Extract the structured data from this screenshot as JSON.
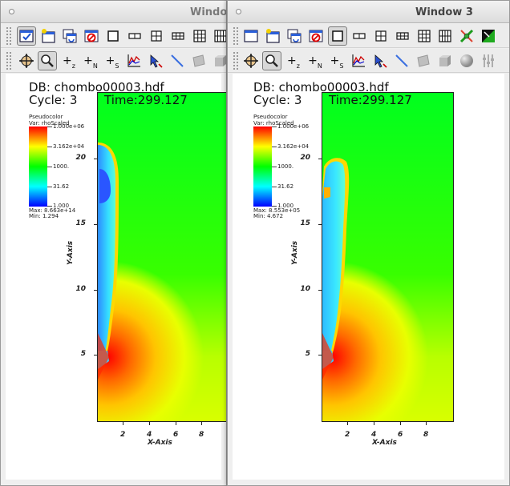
{
  "windows": [
    {
      "id": "left",
      "title": "Windo",
      "annotations": {
        "db": "DB: chombo00003.hdf",
        "cycle": "Cycle: 3",
        "time": "Time:299.127"
      },
      "legend": {
        "title": "Pseudocolor",
        "variable": "Var: rhoScaled",
        "ticks": [
          "1.000e+06",
          "3.162e+04",
          "1000.",
          "31.62",
          "1.000"
        ],
        "max": "Max: 8.663e+14",
        "min": "Min: 1.294"
      }
    },
    {
      "id": "right",
      "title": "Window 3",
      "annotations": {
        "db": "DB: chombo00003.hdf",
        "cycle": "Cycle: 3",
        "time": "Time:299.127"
      },
      "legend": {
        "title": "Pseudocolor",
        "variable": "Var: rhoScaled",
        "ticks": [
          "1.000e+06",
          "3.162e+04",
          "1000.",
          "31.62",
          "1.000"
        ],
        "max": "Max: 8.553e+05",
        "min": "Min: 4.672"
      }
    }
  ],
  "plot": {
    "x_axis_title": "X-Axis",
    "y_axis_title": "Y-Axis",
    "x_ticks": [
      "2",
      "4",
      "6",
      "8"
    ],
    "y_ticks": [
      "20",
      "15",
      "10",
      "5"
    ]
  },
  "toolbar": {
    "row1_icons": [
      "active-window-icon",
      "new-window-icon",
      "clone-window-icon",
      "delete-window-icon",
      "layout-1x1-icon",
      "layout-1x2-icon",
      "layout-2x2-icon",
      "layout-2x3-icon",
      "layout-3x3-icon",
      "lock-view-icon",
      "spin-mode-icon"
    ],
    "row2_icons": [
      "navigate-icon",
      "zoom-icon",
      "zone-pick-icon",
      "node-pick-icon",
      "spreadsheet-pick-icon",
      "curve-icon",
      "pick-icon",
      "line-out-icon",
      "plane-icon",
      "box-icon",
      "sphere-icon",
      "axis-restriction-icon"
    ],
    "button_labels": {
      "zone_pick": "+z",
      "node_pick": "+N",
      "spreadsheet_pick": "+s"
    }
  },
  "colors": {
    "background": "#00ff00",
    "high": "#ff0000",
    "mid_high": "#ffff00",
    "mid_low": "#00ffff",
    "low": "#0000ff"
  }
}
